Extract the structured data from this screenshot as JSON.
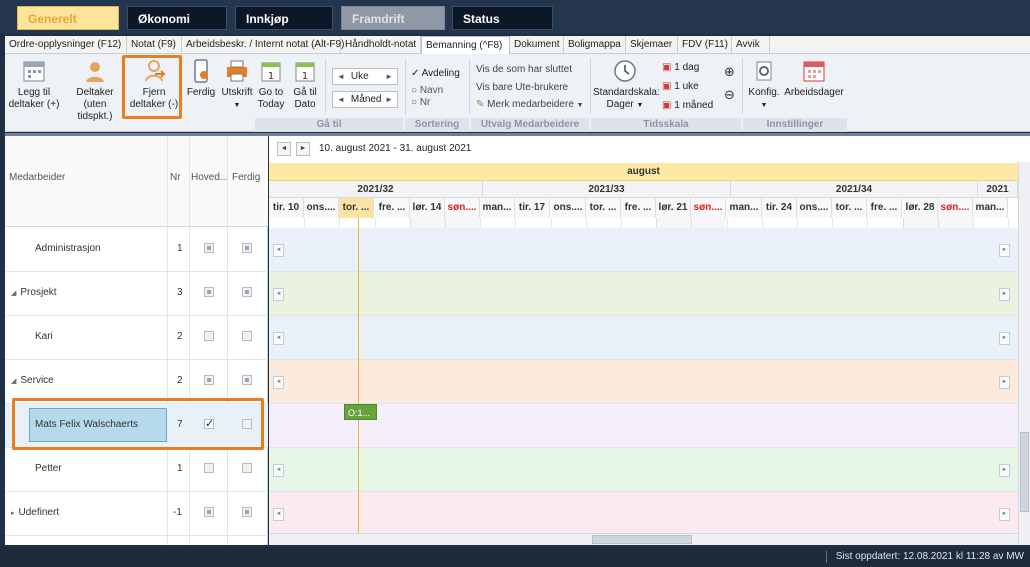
{
  "module_tabs": [
    {
      "label": "Generelt",
      "state": "active"
    },
    {
      "label": "Økonomi",
      "state": "dark"
    },
    {
      "label": "Innkjøp",
      "state": "dark"
    },
    {
      "label": "Framdrift",
      "state": "disabled"
    },
    {
      "label": "Status",
      "state": "dark"
    }
  ],
  "sub_tabs": [
    "Ordre-opplysninger (F12)",
    "Notat (F9)",
    "Arbeidsbeskr. / Internt notat (Alt-F9)",
    "Håndholdt-notat",
    "Bemanning (^F8)",
    "Dokument",
    "Boligmappa",
    "Skjemaer",
    "FDV (F11)",
    "Avvik"
  ],
  "active_sub_tab": "Bemanning (^F8)",
  "ribbon": {
    "legg_til": [
      "Legg til",
      "deltaker (+)"
    ],
    "deltaker_uten": [
      "Deltaker",
      "(uten tidspkt.)"
    ],
    "fjern": [
      "Fjern",
      "deltaker (-)"
    ],
    "ferdig": "Ferdig",
    "utskrift": "Utskrift",
    "go_today": [
      "Go to",
      "Today"
    ],
    "ga_til_dato": [
      "Gå til",
      "Dato"
    ],
    "uke": "Uke",
    "maned": "Måned",
    "avdeling": "Avdeling",
    "navn": "Navn",
    "nr": "Nr",
    "vis_sluttet": "Vis de som har sluttet",
    "vis_ute": "Vis bare Ute-brukere",
    "merk": "Merk medarbeidere",
    "standardskala": [
      "Standardskala:",
      "Dager"
    ],
    "en_dag": "1 dag",
    "en_uke": "1 uke",
    "en_maned": "1 måned",
    "konfig": "Konfig.",
    "arbeidsdager": "Arbeidsdager",
    "groups": [
      "Gå til",
      "Sortering",
      "Utvalg Medarbeidere",
      "Tidsskala",
      "Innstillinger"
    ]
  },
  "grid": {
    "headers": {
      "medarbeider": "Medarbeider",
      "nr": "Nr",
      "hoved": "Hoved...",
      "ferdig": "Ferdig"
    },
    "rows": [
      {
        "name": "Administrasjon",
        "nr": "1",
        "hoved": "filled",
        "ferdig": "filled",
        "caret": "",
        "indent": 1
      },
      {
        "name": "Prosjekt",
        "nr": "3",
        "hoved": "filled",
        "ferdig": "filled",
        "caret": "down",
        "indent": 0
      },
      {
        "name": "Kari",
        "nr": "2",
        "hoved": "empty",
        "ferdig": "empty",
        "caret": "",
        "indent": 1
      },
      {
        "name": "Service",
        "nr": "2",
        "hoved": "filled",
        "ferdig": "filled",
        "caret": "down",
        "indent": 0
      },
      {
        "name": "Mats Felix Walschaerts",
        "nr": "7",
        "hoved": "checked",
        "ferdig": "empty",
        "caret": "",
        "indent": 1,
        "selected": true
      },
      {
        "name": "Petter",
        "nr": "1",
        "hoved": "empty",
        "ferdig": "empty",
        "caret": "",
        "indent": 1
      },
      {
        "name": "Udefinert",
        "nr": "-1",
        "hoved": "filled",
        "ferdig": "filled",
        "caret": "right",
        "indent": 0
      }
    ]
  },
  "timeline": {
    "range": "10. august 2021 - 31. august 2021",
    "month": "august",
    "weeks": [
      "2021/32",
      "2021/33",
      "2021/34",
      "2021"
    ],
    "days": [
      "tir. 10",
      "ons....",
      "tor. ...",
      "fre. ...",
      "lør. 14",
      "søn....",
      "man...",
      "tir. 17",
      "ons....",
      "tor. ...",
      "fre. ...",
      "lør. 21",
      "søn....",
      "man...",
      "tir. 24",
      "ons....",
      "tor. ...",
      "fre. ...",
      "lør. 28",
      "søn....",
      "man..."
    ],
    "row_colors": [
      "#eaf0f9",
      "#eaf3e0",
      "#e8f1f7",
      "#fcebdc",
      "#f3eef9",
      "#e6f6e6",
      "#fbeaef"
    ],
    "booking_label": "O:1..."
  },
  "status_text": "Sist oppdatert: 12.08.2021 kl 11:28 av MW",
  "colors": {
    "highlight": "#e67e22",
    "booking": "#66a33c",
    "today": "#fbe3a3",
    "sunday": "#e01f1f"
  }
}
